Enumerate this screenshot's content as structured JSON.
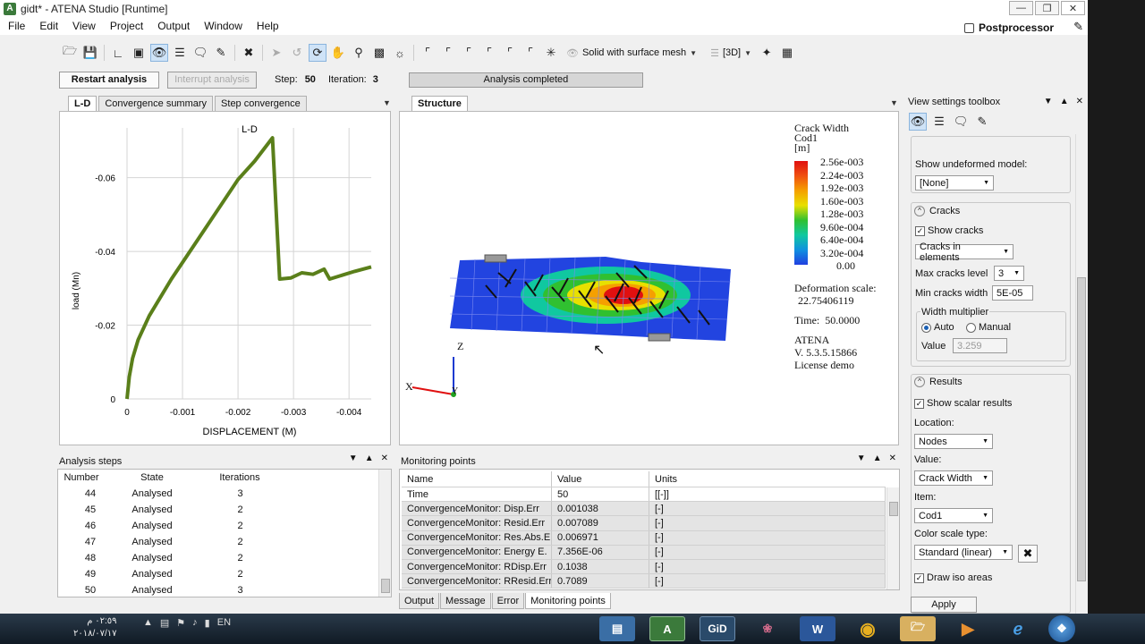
{
  "window": {
    "title": "gidt* - ATENA Studio [Runtime]"
  },
  "menu": [
    "File",
    "Edit",
    "View",
    "Project",
    "Output",
    "Window",
    "Help"
  ],
  "postprocessor": "Postprocessor",
  "toolbar": {
    "display_mode": "Solid with surface mesh",
    "view_mode": "[3D]"
  },
  "actions": {
    "restart": "Restart analysis",
    "interrupt": "Interrupt analysis",
    "step_label": "Step:",
    "step_value": "50",
    "iteration_label": "Iteration:",
    "iteration_value": "3",
    "status": "Analysis completed"
  },
  "left_tabs": [
    "L-D",
    "Convergence summary",
    "Step convergence"
  ],
  "structure_tab": "Structure",
  "chart_data": {
    "type": "line",
    "title": "L-D",
    "xlabel": "DISPLACEMENT (M)",
    "ylabel": "load (Mn)",
    "x_ticks": [
      "0",
      "-0.001",
      "-0.002",
      "-0.003",
      "-0.004"
    ],
    "y_ticks": [
      "0",
      "-0.02",
      "-0.04",
      "-0.06"
    ],
    "xlim": [
      0,
      -0.0044
    ],
    "ylim": [
      0,
      -0.0735
    ],
    "grid": true,
    "color": "#5a7f1a",
    "x": [
      0,
      -4e-05,
      -0.0001,
      -0.0002,
      -0.0004,
      -0.0008,
      -0.0012,
      -0.0016,
      -0.002,
      -0.0023,
      -0.00262,
      -0.00275,
      -0.00295,
      -0.00315,
      -0.00335,
      -0.00355,
      -0.00365,
      -0.0038,
      -0.0041,
      -0.0044
    ],
    "y": [
      0,
      -0.006,
      -0.011,
      -0.016,
      -0.0225,
      -0.0325,
      -0.0415,
      -0.0505,
      -0.0595,
      -0.0645,
      -0.0708,
      -0.0325,
      -0.0328,
      -0.0342,
      -0.0338,
      -0.0352,
      -0.0325,
      -0.0332,
      -0.0346,
      -0.0358
    ]
  },
  "legend": {
    "title_lines": [
      "Crack Width",
      "Cod1",
      "[m]"
    ],
    "values": [
      "2.56e-003",
      "2.24e-003",
      "1.92e-003",
      "1.60e-003",
      "1.28e-003",
      "9.60e-004",
      "6.40e-004",
      "3.20e-004",
      "0.00"
    ],
    "deformation_label": "Deformation scale:",
    "deformation_value": "22.75406119",
    "time_label": "Time:",
    "time_value": "50.0000",
    "product": "ATENA",
    "version": "V. 5.3.5.15866",
    "license": "License demo",
    "axis_z": "Z",
    "axis_x": "X",
    "axis_y": "Y",
    "colors": [
      "#e01010",
      "#f05010",
      "#f5a000",
      "#e8e000",
      "#30c030",
      "#10c8a0",
      "#1090e0",
      "#2040e0"
    ]
  },
  "analysis_steps": {
    "title": "Analysis steps",
    "headers": [
      "Number",
      "State",
      "Iterations"
    ],
    "rows": [
      [
        "44",
        "Analysed",
        "3"
      ],
      [
        "45",
        "Analysed",
        "2"
      ],
      [
        "46",
        "Analysed",
        "2"
      ],
      [
        "47",
        "Analysed",
        "2"
      ],
      [
        "48",
        "Analysed",
        "2"
      ],
      [
        "49",
        "Analysed",
        "2"
      ],
      [
        "50",
        "Analysed",
        "3"
      ]
    ]
  },
  "monitoring": {
    "title": "Monitoring points",
    "headers": [
      "Name",
      "Value",
      "Units"
    ],
    "rows": [
      [
        "Time",
        "50",
        "[[-]]"
      ],
      [
        "ConvergenceMonitor: Disp.Err",
        "0.001038",
        "[-]"
      ],
      [
        "ConvergenceMonitor: Resid.Err",
        "0.007089",
        "[-]"
      ],
      [
        "ConvergenceMonitor: Res.Abs.E",
        "0.006971",
        "[-]"
      ],
      [
        "ConvergenceMonitor: Energy E.",
        "7.356E-06",
        "[-]"
      ],
      [
        "ConvergenceMonitor: RDisp.Err",
        "0.1038",
        "[-]"
      ],
      [
        "ConvergenceMonitor: RResid.Err",
        "0.7089",
        "[-]"
      ]
    ],
    "bottom_tabs": [
      "Output",
      "Message",
      "Error",
      "Monitoring points"
    ]
  },
  "toolbox": {
    "title": "View settings toolbox",
    "show_undeformed_label": "Show undeformed model:",
    "show_undeformed_value": "[None]",
    "cracks_header": "Cracks",
    "show_cracks": "Show cracks",
    "cracks_mode": "Cracks in elements",
    "max_level_label": "Max cracks level",
    "max_level_value": "3",
    "min_width_label": "Min cracks width",
    "min_width_value": "5E-05",
    "width_mult_label": "Width multiplier",
    "auto": "Auto",
    "manual": "Manual",
    "value_label": "Value",
    "value_value": "3.259",
    "results_header": "Results",
    "show_scalar": "Show scalar results",
    "location_label": "Location:",
    "location_value": "Nodes",
    "value2_label": "Value:",
    "value2_value": "Crack Width",
    "item_label": "Item:",
    "item_value": "Cod1",
    "color_scale_label": "Color scale type:",
    "color_scale_value": "Standard (linear)",
    "draw_iso": "Draw iso areas",
    "apply": "Apply"
  },
  "taskbar": {
    "lang": "EN",
    "time": "٠٢:٥٩ م",
    "date": "٢٠١٨/٠٧/١٧",
    "gid": "GiD",
    "word": "W"
  }
}
